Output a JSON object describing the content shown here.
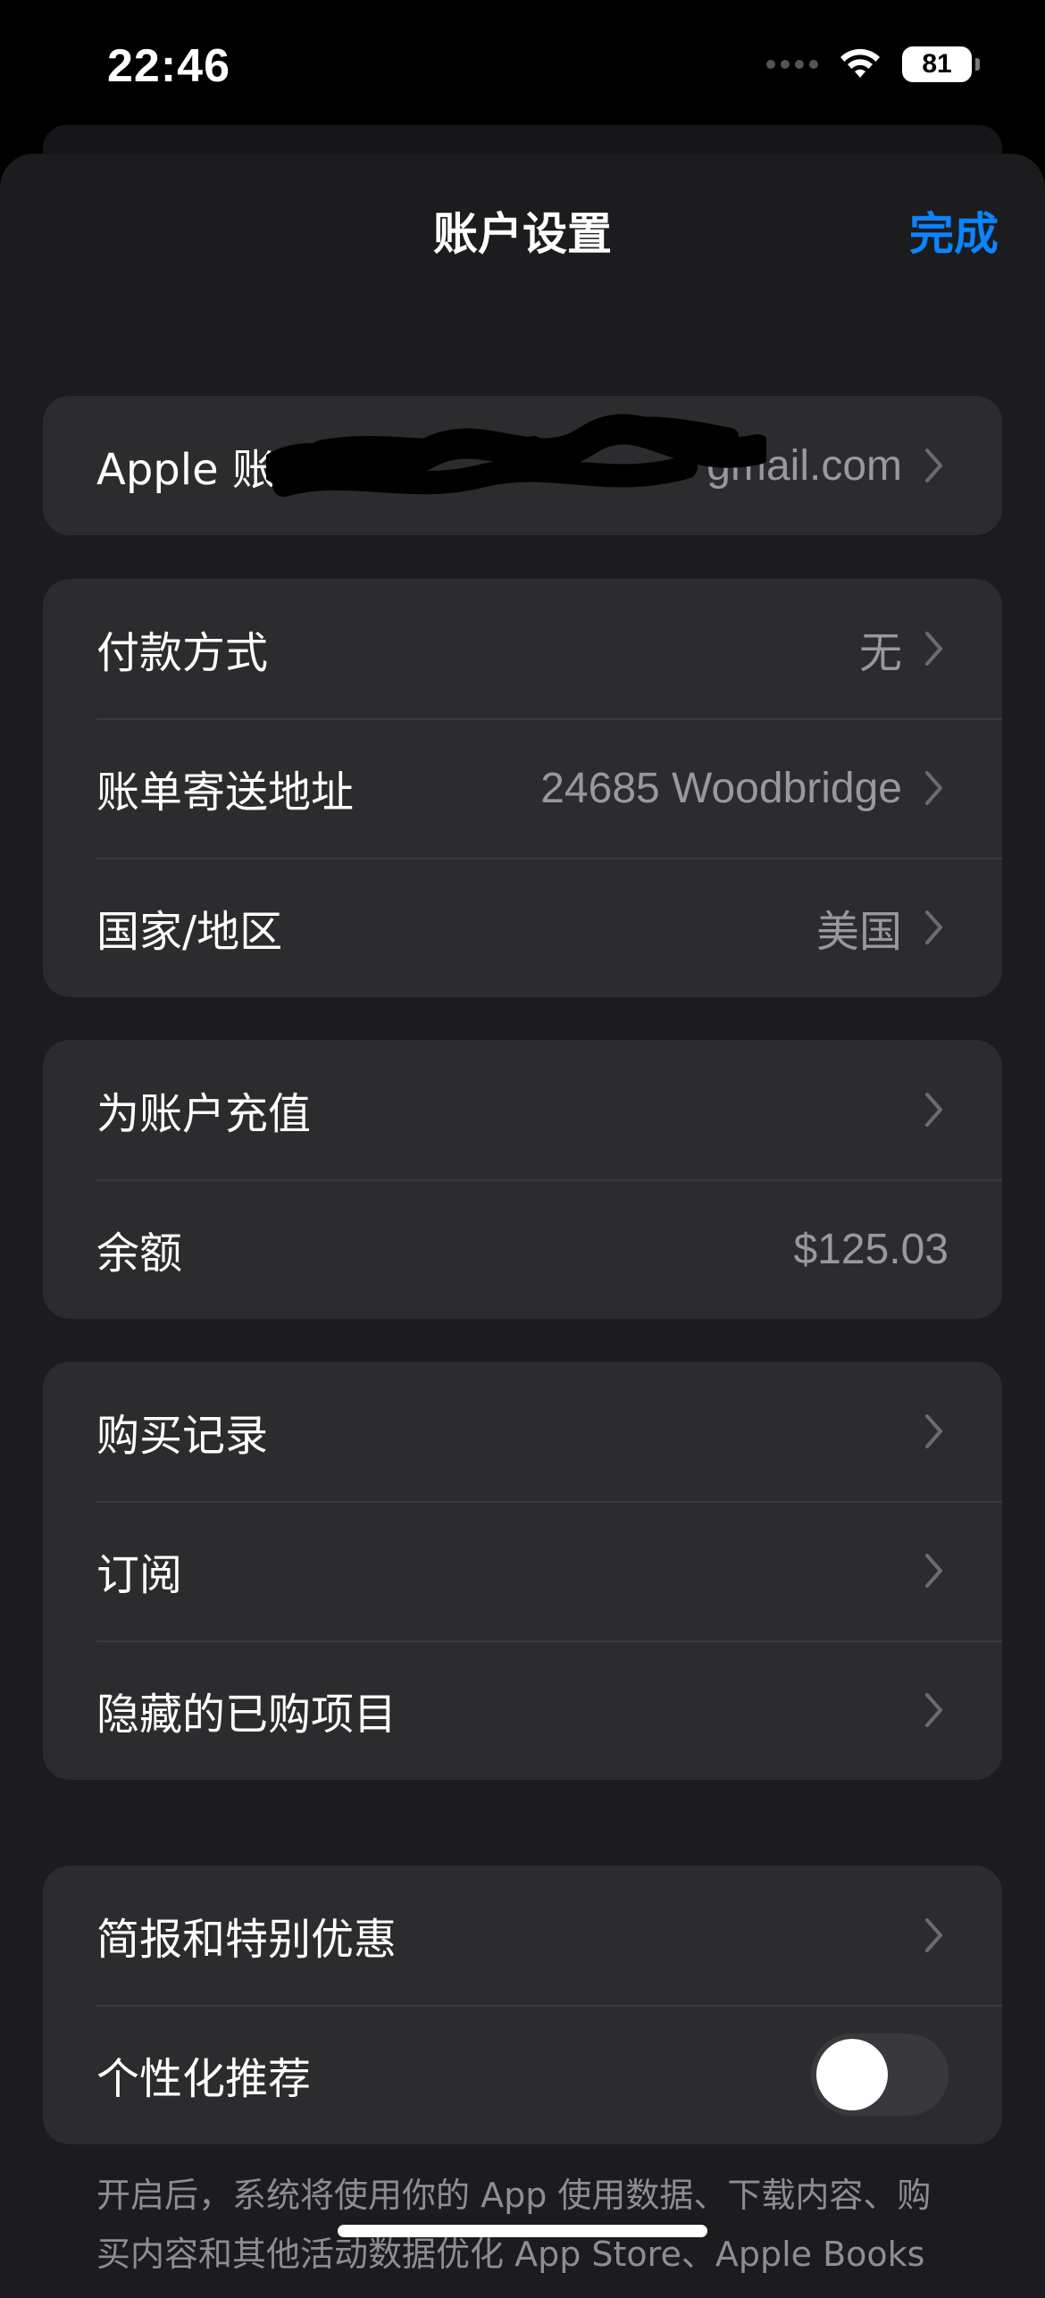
{
  "status_bar": {
    "time": "22:46",
    "battery": "81",
    "icons": [
      "cellular-signal-icon",
      "wifi-icon",
      "battery-icon"
    ]
  },
  "header": {
    "title": "账户设置",
    "done_label": "完成"
  },
  "account": {
    "label": "Apple 账户",
    "value": "gmail.com"
  },
  "billing": {
    "payment_label": "付款方式",
    "payment_value": "无",
    "address_label": "账单寄送地址",
    "address_value": "24685 Woodbridge",
    "region_label": "国家/地区",
    "region_value": "美国"
  },
  "funds": {
    "add_funds_label": "为账户充值",
    "balance_label": "余额",
    "balance_value": "$125.03"
  },
  "purchases": {
    "history_label": "购买记录",
    "subscriptions_label": "订阅",
    "hidden_label": "隐藏的已购项目"
  },
  "preferences": {
    "newsletter_label": "简报和特别优惠",
    "personalized_label": "个性化推荐",
    "personalized_on": false
  },
  "footnote": "开启后，系统将使用你的 App 使用数据、下载内容、购买内容和其他活动数据优化 App Store、Apple Books",
  "colors": {
    "accent": "#0a84ff",
    "sheet_bg": "#1c1c1e",
    "group_bg": "#2c2c2e",
    "secondary_text": "#98989f"
  }
}
